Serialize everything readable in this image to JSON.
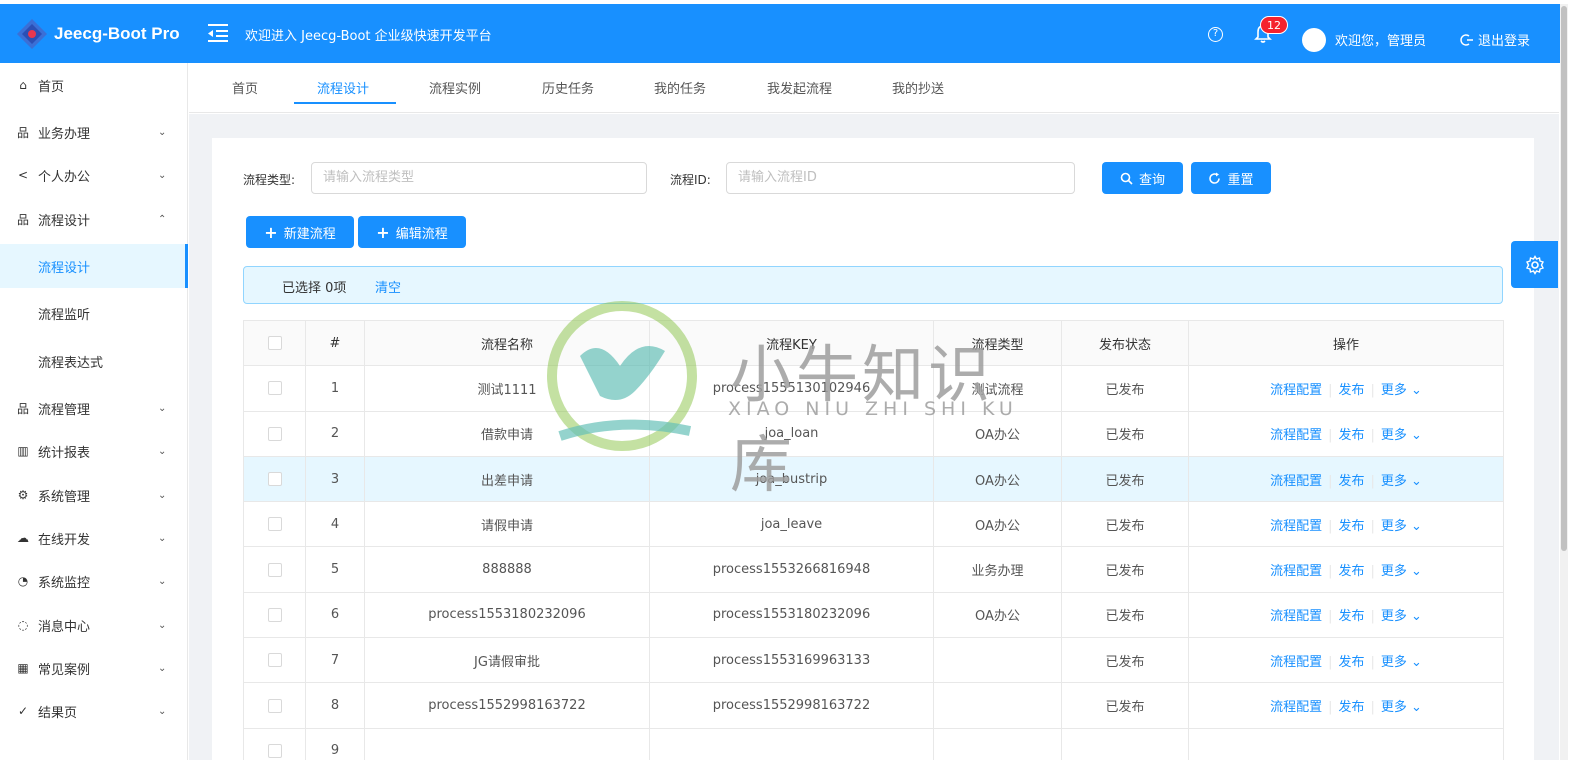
{
  "app": {
    "logo_text": "Jeecg-Boot Pro",
    "platform_welcome": "欢迎进入 Jeecg-Boot 企业级快速开发平台"
  },
  "header": {
    "notification_count": "12",
    "user_greeting": "欢迎您，管理员",
    "logout_label": "退出登录",
    "help_glyph": "?"
  },
  "sidebar": {
    "items": [
      {
        "label": "首页",
        "icon": "home-icon",
        "chevron": ""
      },
      {
        "label": "业务办理",
        "icon": "sitemap-icon",
        "chevron": "⌄"
      },
      {
        "label": "个人办公",
        "icon": "share-icon",
        "chevron": "⌄"
      },
      {
        "label": "流程设计",
        "icon": "sitemap-icon",
        "chevron": "⌃"
      },
      {
        "label": "流程设计",
        "icon": "",
        "chevron": "",
        "sub": true,
        "active": true
      },
      {
        "label": "流程监听",
        "icon": "",
        "chevron": "",
        "sub": true
      },
      {
        "label": "流程表达式",
        "icon": "",
        "chevron": "",
        "sub": true
      },
      {
        "label": "流程管理",
        "icon": "sitemap-icon",
        "chevron": "⌄"
      },
      {
        "label": "统计报表",
        "icon": "bar-chart-icon",
        "chevron": "⌄"
      },
      {
        "label": "系统管理",
        "icon": "gear-icon",
        "chevron": "⌄"
      },
      {
        "label": "在线开发",
        "icon": "cloud-icon",
        "chevron": "⌄"
      },
      {
        "label": "系统监控",
        "icon": "dashboard-icon",
        "chevron": "⌄"
      },
      {
        "label": "消息中心",
        "icon": "message-icon",
        "chevron": "⌄"
      },
      {
        "label": "常见案例",
        "icon": "grid-icon",
        "chevron": "⌄"
      },
      {
        "label": "结果页",
        "icon": "check-circle-icon",
        "chevron": "⌄"
      }
    ]
  },
  "tabs": [
    {
      "label": "首页"
    },
    {
      "label": "流程设计"
    },
    {
      "label": "流程实例"
    },
    {
      "label": "历史任务"
    },
    {
      "label": "我的任务"
    },
    {
      "label": "我发起流程"
    },
    {
      "label": "我的抄送"
    }
  ],
  "search": {
    "type_label": "流程类型:",
    "type_placeholder": "请输入流程类型",
    "id_label": "流程ID:",
    "id_placeholder": "请输入流程ID",
    "query_label": "查询",
    "reset_label": "重置"
  },
  "toolbar": {
    "new_label": "新建流程",
    "edit_label": "编辑流程"
  },
  "selection": {
    "text": "已选择 0项",
    "clear_label": "清空"
  },
  "table": {
    "headers": [
      "#",
      "流程名称",
      "流程KEY",
      "流程类型",
      "发布状态",
      "操作"
    ],
    "rows": [
      [
        "1",
        "测试1111",
        "process1555130102946",
        "测试流程",
        "已发布"
      ],
      [
        "2",
        "借款申请",
        "joa_loan",
        "OA办公",
        "已发布"
      ],
      [
        "3",
        "出差申请",
        "joa_bustrip",
        "OA办公",
        "已发布"
      ],
      [
        "4",
        "请假申请",
        "joa_leave",
        "OA办公",
        "已发布"
      ],
      [
        "5",
        "888888",
        "process1553266816948",
        "业务办理",
        "已发布"
      ],
      [
        "6",
        "process1553180232096",
        "process1553180232096",
        "OA办公",
        "已发布"
      ],
      [
        "7",
        "JG请假审批",
        "process1553169963133",
        "",
        "已发布"
      ],
      [
        "8",
        "process1552998163722",
        "process1552998163722",
        "",
        "已发布"
      ],
      [
        "9",
        "",
        "",
        "",
        ""
      ]
    ],
    "actions": {
      "config": "流程配置",
      "publish": "发布",
      "more": "更多 ⌄"
    }
  },
  "watermark": {
    "cn": "小牛知识库",
    "en": "XIAO NIU ZHI SHI KU"
  },
  "colors": {
    "primary": "#1890ff",
    "badge": "#f5222d",
    "highlight_row": "#e6f7ff"
  }
}
